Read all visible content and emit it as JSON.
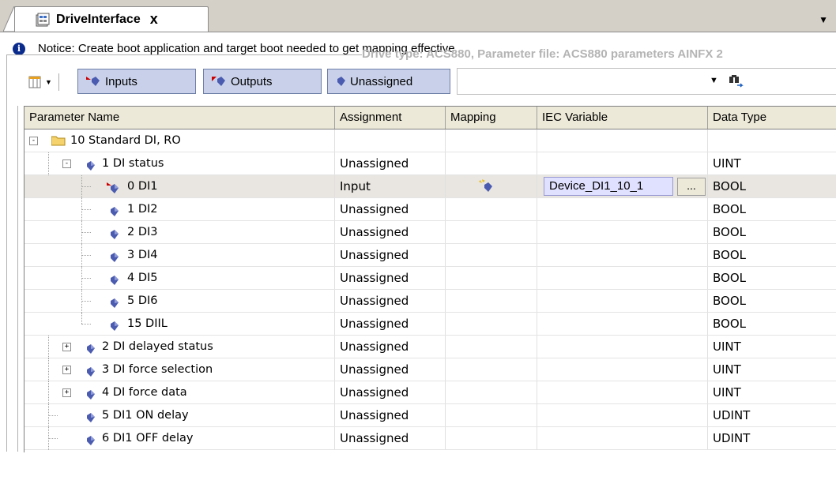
{
  "tab": {
    "title": "DriveInterface",
    "close": "x",
    "menu": "▼"
  },
  "notice": {
    "text": "Notice: Create boot application and target boot needed to get mapping effective"
  },
  "drive_type": "Drive type: ACS880, Parameter file: ACS880 parameters AINFX 2",
  "toolbar": {
    "inputs": "Inputs",
    "outputs": "Outputs",
    "unassigned": "Unassigned",
    "search_value": "",
    "search_dropdown": "▼"
  },
  "columns": [
    "Parameter Name",
    "Assignment",
    "Mapping",
    "IEC Variable",
    "Data Type"
  ],
  "rows": [
    {
      "name": "10 Standard DI, RO",
      "assignment": "",
      "iec": "",
      "type": ""
    },
    {
      "name": "1 DI status",
      "assignment": "Unassigned",
      "iec": "",
      "type": "UINT"
    },
    {
      "name": "0 DI1",
      "assignment": "Input",
      "iec": "Device_DI1_10_1",
      "type": "BOOL",
      "dots": "..."
    },
    {
      "name": "1 DI2",
      "assignment": "Unassigned",
      "iec": "",
      "type": "BOOL"
    },
    {
      "name": "2 DI3",
      "assignment": "Unassigned",
      "iec": "",
      "type": "BOOL"
    },
    {
      "name": "3 DI4",
      "assignment": "Unassigned",
      "iec": "",
      "type": "BOOL"
    },
    {
      "name": "4 DI5",
      "assignment": "Unassigned",
      "iec": "",
      "type": "BOOL"
    },
    {
      "name": "5 DI6",
      "assignment": "Unassigned",
      "iec": "",
      "type": "BOOL"
    },
    {
      "name": "15 DIIL",
      "assignment": "Unassigned",
      "iec": "",
      "type": "BOOL"
    },
    {
      "name": "2 DI delayed status",
      "assignment": "Unassigned",
      "iec": "",
      "type": "UINT"
    },
    {
      "name": "3 DI force selection",
      "assignment": "Unassigned",
      "iec": "",
      "type": "UINT"
    },
    {
      "name": "4 DI force data",
      "assignment": "Unassigned",
      "iec": "",
      "type": "UINT"
    },
    {
      "name": "5 DI1 ON delay",
      "assignment": "Unassigned",
      "iec": "",
      "type": "UDINT"
    },
    {
      "name": "6 DI1 OFF delay",
      "assignment": "Unassigned",
      "iec": "",
      "type": "UDINT"
    }
  ],
  "colors": {
    "selected_row": "#e9e6e1",
    "toolbar_button": "#c9d1ea",
    "iec_input": "#e0e0ff",
    "param_icon": "#4a5bb0"
  }
}
